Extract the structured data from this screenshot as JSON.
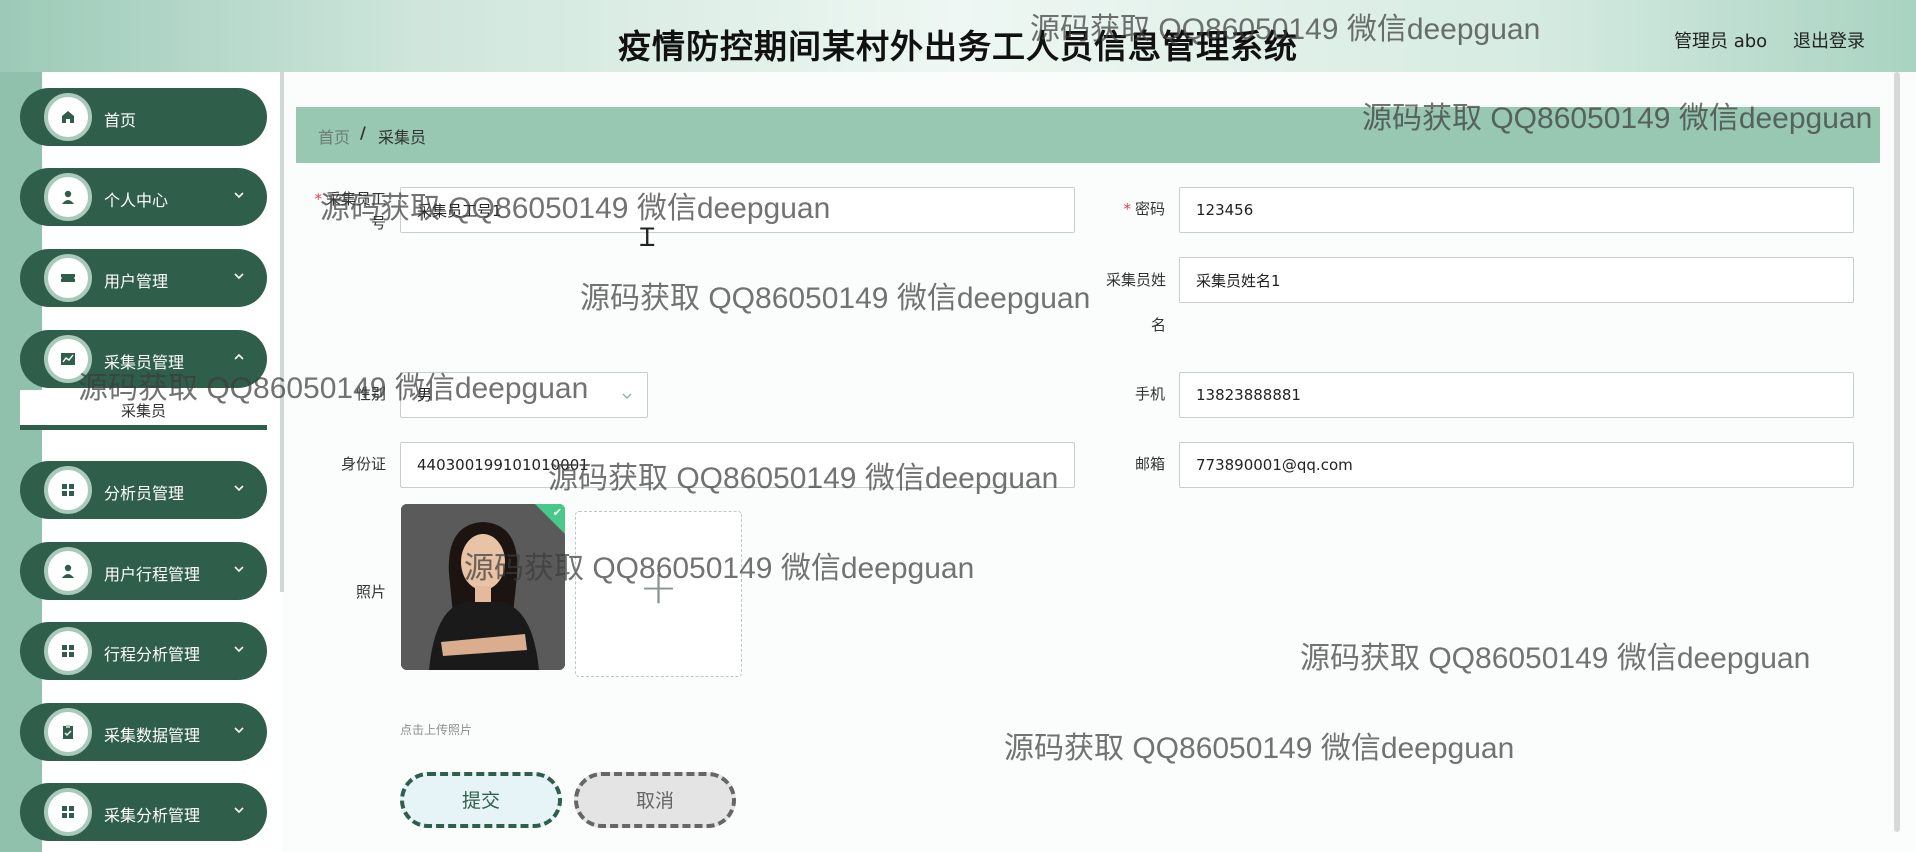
{
  "header": {
    "title": "疫情防控期间某村外出务工人员信息管理系统",
    "user": "管理员 abo",
    "logout": "退出登录"
  },
  "sidebar": {
    "items": [
      {
        "label": "首页",
        "icon": "home-icon"
      },
      {
        "label": "个人中心",
        "icon": "user-icon"
      },
      {
        "label": "用户管理",
        "icon": "ticket-icon"
      },
      {
        "label": "采集员管理",
        "icon": "chart-icon"
      },
      {
        "label": "分析员管理",
        "icon": "grid-icon"
      },
      {
        "label": "用户行程管理",
        "icon": "person-icon"
      },
      {
        "label": "行程分析管理",
        "icon": "grid-icon"
      },
      {
        "label": "采集数据管理",
        "icon": "clipboard-icon"
      },
      {
        "label": "采集分析管理",
        "icon": "grid-icon"
      }
    ],
    "submenu_label": "采集员"
  },
  "breadcrumb": {
    "home": "首页",
    "separator": "/",
    "current": "采集员"
  },
  "form": {
    "worker_id": {
      "label": "采集员工号",
      "value": "采集员工号1"
    },
    "password": {
      "label": "密码",
      "value": "123456"
    },
    "name": {
      "label": "采集员姓名",
      "value": "采集员姓名1"
    },
    "gender": {
      "label": "性别",
      "value": "男"
    },
    "phone": {
      "label": "手机",
      "value": "13823888881"
    },
    "id_card": {
      "label": "身份证",
      "value": "440300199101010001"
    },
    "email": {
      "label": "邮箱",
      "value": "773890001@qq.com"
    },
    "photo": {
      "label": "照片",
      "hint": "点击上传照片",
      "add_symbol": "+"
    },
    "submit": "提交",
    "cancel": "取消"
  },
  "watermark": "源码获取 QQ86050149 微信deepguan"
}
